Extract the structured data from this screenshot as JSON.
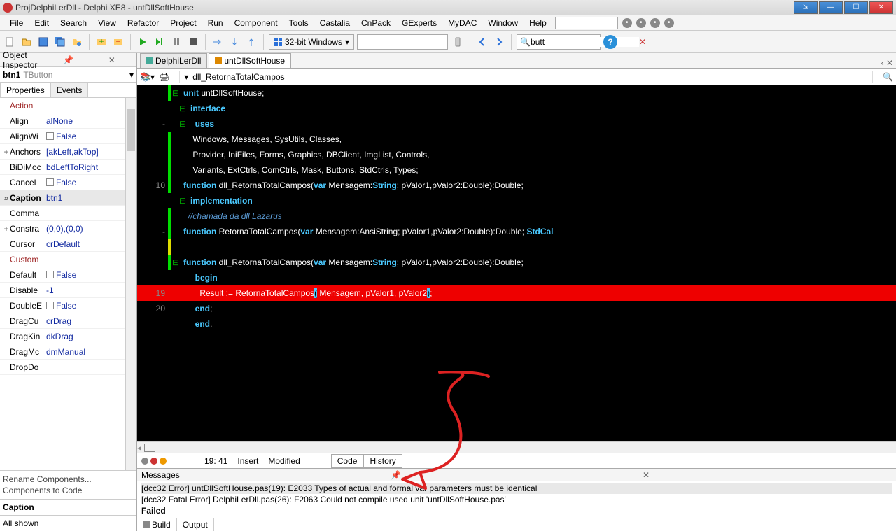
{
  "title": "ProjDelphiLerDll - Delphi XE8 - untDllSoftHouse",
  "menu": [
    "File",
    "Edit",
    "Search",
    "View",
    "Refactor",
    "Project",
    "Run",
    "Component",
    "Tools",
    "Castalia",
    "CnPack",
    "GExperts",
    "MyDAC",
    "Window",
    "Help"
  ],
  "platform": "32-bit Windows",
  "search_value": "butt",
  "oi": {
    "title": "Object Inspector",
    "component_name": "btn1",
    "component_type": "TButton",
    "tabs": [
      "Properties",
      "Events"
    ],
    "rows": [
      {
        "k": "Action",
        "v": "",
        "red": true
      },
      {
        "k": "Align",
        "v": "alNone"
      },
      {
        "k": "AlignWithMargins",
        "v": "False",
        "cb": true,
        "truncK": "AlignWi"
      },
      {
        "k": "Anchors",
        "v": "[akLeft,akTop]",
        "exp": "+"
      },
      {
        "k": "BiDiMode",
        "v": "bdLeftToRight",
        "truncK": "BiDiMoc"
      },
      {
        "k": "Cancel",
        "v": "False",
        "cb": true
      },
      {
        "k": "Caption",
        "v": "btn1",
        "sel": true,
        "exp": "»"
      },
      {
        "k": "CommandLinkHint",
        "v": "",
        "truncK": "Comma"
      },
      {
        "k": "Constraints",
        "v": "(0,0),(0,0)",
        "exp": "+",
        "truncK": "Constra"
      },
      {
        "k": "Cursor",
        "v": "crDefault"
      },
      {
        "k": "CustomHint",
        "v": "",
        "truncK": "Custom",
        "red": true
      },
      {
        "k": "Default",
        "v": "False",
        "cb": true
      },
      {
        "k": "DisabledImageIndex",
        "v": "-1",
        "truncK": "Disable"
      },
      {
        "k": "DoubleBuffered",
        "v": "False",
        "cb": true,
        "truncK": "DoubleE"
      },
      {
        "k": "DragCursor",
        "v": "crDrag",
        "truncK": "DragCu"
      },
      {
        "k": "DragKind",
        "v": "dkDrag",
        "truncK": "DragKin"
      },
      {
        "k": "DragMode",
        "v": "dmManual",
        "truncK": "DragMc"
      },
      {
        "k": "DropDownMenu",
        "v": "",
        "truncK": "DropDo"
      }
    ],
    "links": [
      "Rename Components...",
      "Components to Code"
    ],
    "caption": "Caption",
    "shown": "All shown"
  },
  "editor": {
    "tabs": [
      {
        "label": "DelphiLerDll",
        "active": false
      },
      {
        "label": "untDllSoftHouse",
        "active": true,
        "mod": true
      }
    ],
    "fn_combo": "dll_RetornaTotalCampos",
    "status": {
      "pos": "19: 41",
      "mode": "Insert",
      "state": "Modified",
      "tabs": [
        "Code",
        "History"
      ]
    }
  },
  "code": [
    {
      "g": "",
      "f": "⊟",
      "bar": "g",
      "t": [
        [
          "kw",
          "unit "
        ],
        [
          "id",
          "untDllSoftHouse;"
        ]
      ]
    },
    {
      "g": "",
      "t": []
    },
    {
      "g": "",
      "f": "⊟",
      "t": [
        [
          "kw",
          "interface"
        ]
      ]
    },
    {
      "g": "",
      "t": []
    },
    {
      "g": "-",
      "f": "⊟",
      "t": [
        [
          "kw",
          "  uses"
        ]
      ]
    },
    {
      "g": "",
      "bar": "g",
      "t": [
        [
          "id",
          "    Windows, Messages, SysUtils, Classes,"
        ]
      ]
    },
    {
      "g": "",
      "bar": "g",
      "t": [
        [
          "id",
          "    Provider, IniFiles, Forms, Graphics, DBClient, ImgList, Controls,"
        ]
      ]
    },
    {
      "g": "",
      "bar": "g",
      "t": [
        [
          "id",
          "    Variants, ExtCtrls, ComCtrls, Mask, Buttons, StdCtrls, Types;"
        ]
      ]
    },
    {
      "g": "",
      "t": []
    },
    {
      "g": "10",
      "bar": "g",
      "t": [
        [
          "kw",
          "function "
        ],
        [
          "id",
          "dll_RetornaTotalCampos("
        ],
        [
          "kw",
          "var "
        ],
        [
          "id",
          "Mensagem:"
        ],
        [
          "kw",
          "String"
        ],
        [
          "id",
          "; pValor1,pValor2:Double):Double;"
        ]
      ]
    },
    {
      "g": "",
      "t": []
    },
    {
      "g": "",
      "f": "⊟",
      "t": [
        [
          "kw",
          "implementation"
        ]
      ]
    },
    {
      "g": "",
      "t": []
    },
    {
      "g": "",
      "bar": "g",
      "t": [
        [
          "cm",
          "  //chamada da dll Lazarus"
        ]
      ]
    },
    {
      "g": "-",
      "bar": "g",
      "t": [
        [
          "kw",
          "function "
        ],
        [
          "id",
          "RetornaTotalCampos("
        ],
        [
          "kw",
          "var "
        ],
        [
          "id",
          "Mensagem:AnsiString; pValor1,pValor2:Double):Double; "
        ],
        [
          "kw",
          "StdCal"
        ]
      ]
    },
    {
      "g": "",
      "bar": "y",
      "t": []
    },
    {
      "g": "",
      "f": "⊟",
      "bar": "g",
      "t": [
        [
          "kw",
          "function "
        ],
        [
          "id",
          "dll_RetornaTotalCampos("
        ],
        [
          "kw",
          "var "
        ],
        [
          "id",
          "Mensagem:"
        ],
        [
          "kw",
          "String"
        ],
        [
          "id",
          "; pValor1,pValor2:Double):Double;"
        ]
      ]
    },
    {
      "g": "",
      "t": [
        [
          "kw",
          "  begin"
        ]
      ]
    },
    {
      "g": "19",
      "err": true,
      "t": [
        [
          "id",
          "    Result := RetornaTotalCampos"
        ],
        [
          "hl",
          "("
        ],
        [
          "id",
          " Mensagem, pValor1, pValor2"
        ],
        [
          "hl",
          ")"
        ],
        [
          "id",
          ";"
        ]
      ]
    },
    {
      "g": "20",
      "t": [
        [
          "kw",
          "  end"
        ],
        [
          "id",
          ";"
        ]
      ]
    },
    {
      "g": "",
      "t": []
    },
    {
      "g": "",
      "t": [
        [
          "kw",
          "  end"
        ],
        [
          "id",
          "."
        ]
      ]
    }
  ],
  "messages": {
    "title": "Messages",
    "lines": [
      {
        "t": "[dcc32 Error] untDllSoftHouse.pas(19): E2033 Types of actual and formal var parameters must be identical",
        "sel": true
      },
      {
        "t": "[dcc32 Fatal Error] DelphiLerDll.pas(26): F2063 Could not compile used unit 'untDllSoftHouse.pas'"
      },
      {
        "t": "Failed",
        "fail": true
      }
    ],
    "tabs": [
      "Build",
      "Output"
    ]
  }
}
